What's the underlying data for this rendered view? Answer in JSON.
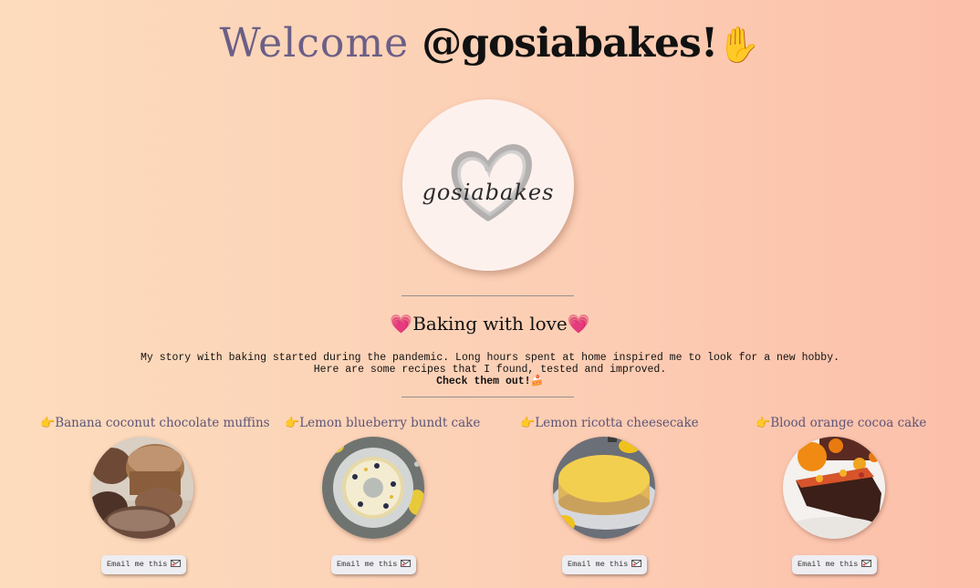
{
  "header": {
    "welcome": "Welcome",
    "handle": "@gosiabakes!",
    "wave_icon": "waving-hand-icon"
  },
  "logo": {
    "text": "gosiabakes",
    "icon": "heart-scribble-icon"
  },
  "intro": {
    "subtitle": "Baking with love",
    "heart_icon": "heart-icon",
    "story_line_1": "My story with baking started during the pandemic. Long hours spent at home inspired me to look for a new hobby.",
    "story_line_2": "Here are some recipes that I found, tested and improved.",
    "cta": "Check them out!",
    "cta_icon": "cake-slice-icon"
  },
  "recipes": [
    {
      "title": "Banana coconut chocolate muffins",
      "pointer_icon": "pointing-hand-icon",
      "email_label": "Email me this",
      "email_icon": "envelope-icon"
    },
    {
      "title": "Lemon blueberry bundt cake",
      "pointer_icon": "pointing-hand-icon",
      "email_label": "Email me this",
      "email_icon": "envelope-icon"
    },
    {
      "title": "Lemon ricotta cheesecake",
      "pointer_icon": "pointing-hand-icon",
      "email_label": "Email me this",
      "email_icon": "envelope-icon"
    },
    {
      "title": "Blood orange cocoa cake",
      "pointer_icon": "pointing-hand-icon",
      "email_label": "Email me this",
      "email_icon": "envelope-icon"
    }
  ],
  "colors": {
    "background_left": "#fddcbd",
    "background_right": "#fcbfa9",
    "accent_purple": "#6b5f86"
  }
}
